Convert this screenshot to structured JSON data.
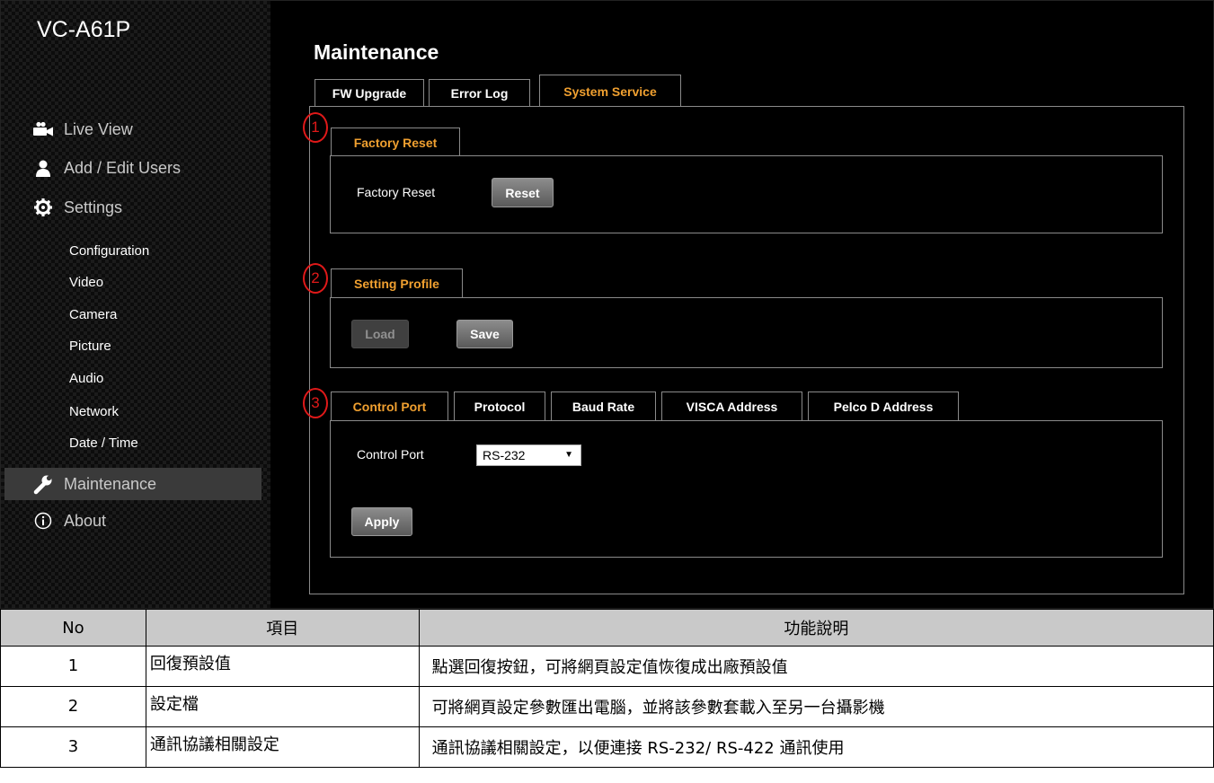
{
  "device": {
    "model": "VC-A61P"
  },
  "sidebar": {
    "main_items": [
      {
        "label": "Live View",
        "icon": "video-camera-icon"
      },
      {
        "label": "Add / Edit Users",
        "icon": "user-icon"
      },
      {
        "label": "Settings",
        "icon": "gear-icon"
      }
    ],
    "sub_items": [
      "Configuration",
      "Video",
      "Camera",
      "Picture",
      "Audio",
      "Network",
      "Date / Time"
    ],
    "bottom_items": [
      {
        "label": "Maintenance",
        "icon": "wrench-icon",
        "active": true
      },
      {
        "label": "About",
        "icon": "info-icon"
      }
    ]
  },
  "main": {
    "title": "Maintenance",
    "tabs": [
      {
        "label": "FW Upgrade"
      },
      {
        "label": "Error Log"
      },
      {
        "label": "System Service",
        "active": true
      }
    ],
    "factory_reset": {
      "callout": "1",
      "tab_label": "Factory Reset",
      "field_label": "Factory Reset",
      "button_label": "Reset"
    },
    "setting_profile": {
      "callout": "2",
      "tab_label": "Setting Profile",
      "load_label": "Load",
      "save_label": "Save"
    },
    "control": {
      "callout": "3",
      "tabs": [
        {
          "label": "Control Port",
          "active": true
        },
        {
          "label": "Protocol"
        },
        {
          "label": "Baud Rate"
        },
        {
          "label": "VISCA Address"
        },
        {
          "label": "Pelco D Address"
        }
      ],
      "field_label": "Control Port",
      "select_value": "RS-232",
      "apply_label": "Apply"
    }
  },
  "table": {
    "headers": [
      "No",
      "項目",
      "功能說明"
    ],
    "rows": [
      {
        "no": "1",
        "item": "回復預設值",
        "desc": "點選回復按鈕，可將網頁設定值恢復成出廠預設值"
      },
      {
        "no": "2",
        "item": "設定檔",
        "desc": "可將網頁設定參數匯出電腦，並將該參數套載入至另一台攝影機"
      },
      {
        "no": "3",
        "item": "通訊協議相關設定",
        "desc": "通訊協議相關設定，以便連接 RS-232/ RS-422 通訊使用"
      }
    ]
  },
  "colors": {
    "accent": "#f0a030",
    "callout": "#e01919",
    "header_bg": "#c9c9c9"
  }
}
